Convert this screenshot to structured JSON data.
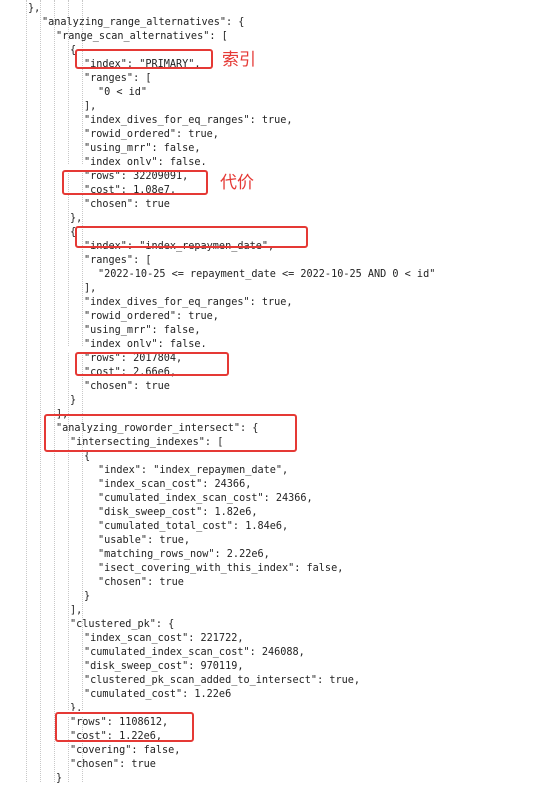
{
  "annotations": {
    "index_note": "索引",
    "cost_note": "代价"
  },
  "lines": [
    {
      "t": "},",
      "i": 1
    },
    {
      "t": "\"analyzing_range_alternatives\": {",
      "i": 2
    },
    {
      "t": "\"range_scan_alternatives\": [",
      "i": 3
    },
    {
      "t": "{",
      "i": 4
    },
    {
      "t": "\"index\": \"PRIMARY\",",
      "i": 5
    },
    {
      "t": "\"ranges\": [",
      "i": 5
    },
    {
      "t": "\"0 < id\"",
      "i": 6
    },
    {
      "t": "],",
      "i": 5
    },
    {
      "t": "\"index_dives_for_eq_ranges\": true,",
      "i": 5
    },
    {
      "t": "\"rowid_ordered\": true,",
      "i": 5
    },
    {
      "t": "\"using_mrr\": false,",
      "i": 5
    },
    {
      "t": "\"index_only\": false,",
      "i": 5
    },
    {
      "t": "\"rows\": 32209091,",
      "i": 5
    },
    {
      "t": "\"cost\": 1.08e7,",
      "i": 5
    },
    {
      "t": "\"chosen\": true",
      "i": 5
    },
    {
      "t": "},",
      "i": 4
    },
    {
      "t": "{",
      "i": 4
    },
    {
      "t": "\"index\": \"index_repaymen_date\",",
      "i": 5
    },
    {
      "t": "\"ranges\": [",
      "i": 5
    },
    {
      "t": "\"2022-10-25 <= repayment_date <= 2022-10-25 AND 0 < id\"",
      "i": 6
    },
    {
      "t": "],",
      "i": 5
    },
    {
      "t": "\"index_dives_for_eq_ranges\": true,",
      "i": 5
    },
    {
      "t": "\"rowid_ordered\": true,",
      "i": 5
    },
    {
      "t": "\"using_mrr\": false,",
      "i": 5
    },
    {
      "t": "\"index_only\": false,",
      "i": 5
    },
    {
      "t": "\"rows\": 2017804,",
      "i": 5
    },
    {
      "t": "\"cost\": 2.66e6,",
      "i": 5
    },
    {
      "t": "\"chosen\": true",
      "i": 5
    },
    {
      "t": "}",
      "i": 4
    },
    {
      "t": "],",
      "i": 3
    },
    {
      "t": "\"analyzing_roworder_intersect\": {",
      "i": 3
    },
    {
      "t": "\"intersecting_indexes\": [",
      "i": 4
    },
    {
      "t": "{",
      "i": 5
    },
    {
      "t": "\"index\": \"index_repaymen_date\",",
      "i": 6
    },
    {
      "t": "\"index_scan_cost\": 24366,",
      "i": 6
    },
    {
      "t": "\"cumulated_index_scan_cost\": 24366,",
      "i": 6
    },
    {
      "t": "\"disk_sweep_cost\": 1.82e6,",
      "i": 6
    },
    {
      "t": "\"cumulated_total_cost\": 1.84e6,",
      "i": 6
    },
    {
      "t": "\"usable\": true,",
      "i": 6
    },
    {
      "t": "\"matching_rows_now\": 2.22e6,",
      "i": 6
    },
    {
      "t": "\"isect_covering_with_this_index\": false,",
      "i": 6
    },
    {
      "t": "\"chosen\": true",
      "i": 6
    },
    {
      "t": "}",
      "i": 5
    },
    {
      "t": "],",
      "i": 4
    },
    {
      "t": "\"clustered_pk\": {",
      "i": 4
    },
    {
      "t": "\"index_scan_cost\": 221722,",
      "i": 5
    },
    {
      "t": "\"cumulated_index_scan_cost\": 246088,",
      "i": 5
    },
    {
      "t": "\"disk_sweep_cost\": 970119,",
      "i": 5
    },
    {
      "t": "\"clustered_pk_scan_added_to_intersect\": true,",
      "i": 5
    },
    {
      "t": "\"cumulated_cost\": 1.22e6",
      "i": 5
    },
    {
      "t": "},",
      "i": 4
    },
    {
      "t": "\"rows\": 1108612,",
      "i": 4
    },
    {
      "t": "\"cost\": 1.22e6,",
      "i": 4
    },
    {
      "t": "\"covering\": false,",
      "i": 4
    },
    {
      "t": "\"chosen\": true",
      "i": 4
    },
    {
      "t": "}",
      "i": 3
    }
  ],
  "colors": {
    "highlight": "#e53935",
    "text": "#222222",
    "guide": "#c8c8c8"
  }
}
